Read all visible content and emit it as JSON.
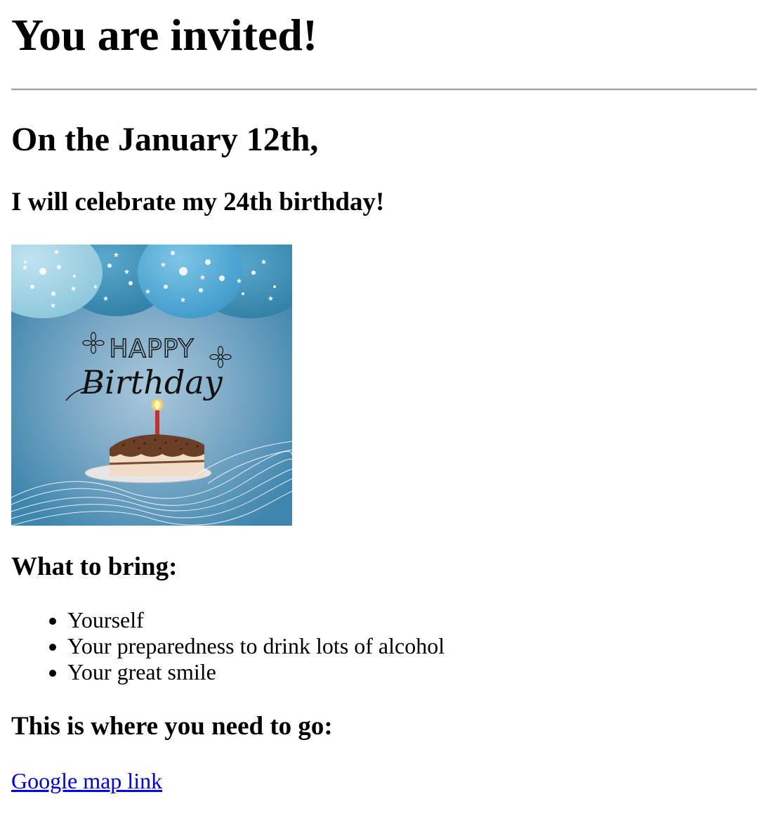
{
  "heading": "You are invited!",
  "date_line": "On the January 12th,",
  "celebrate_line": "I will celebrate my 24th birthday!",
  "card": {
    "happy_text": "HAPPY",
    "birthday_text": "Birthday",
    "colors": {
      "background": "#4a8db5",
      "balloon_light": "#9ccfe0",
      "balloon_mid": "#3f8fb8",
      "balloon_bright": "#4fa9d4",
      "candle": "#c8302a",
      "frosting": "#6b3f26",
      "cake": "#f1dcc7"
    }
  },
  "bring": {
    "heading": "What to bring:",
    "items": [
      "Yourself",
      "Your preparedness to drink lots of alcohol",
      "Your great smile"
    ]
  },
  "location": {
    "heading": "This is where you need to go:",
    "link_text": "Google map link"
  },
  "colors": {
    "link": "#0000ee",
    "divider": "#a0a0a0"
  }
}
